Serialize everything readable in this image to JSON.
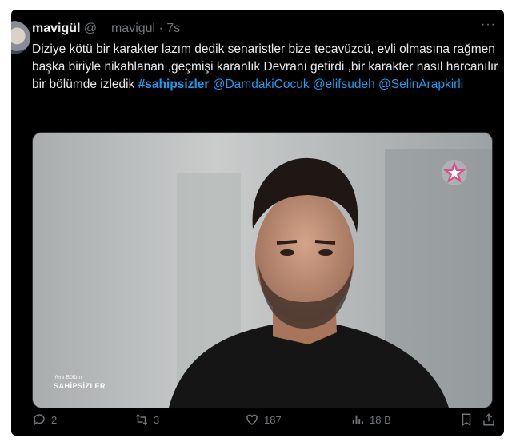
{
  "tweet": {
    "display_name": "mavigül",
    "handle": "@__mavigul",
    "separator": "·",
    "time": "7s",
    "more_label": "···",
    "text_before": "Diziye kötü bir karakter lazım dedik senaristler bize tecavüzcü, evli olmasına rağmen başka biriyle nikahlanan ,geçmişi karanlık Devranı getirdi ,bir karakter nasıl harcanılır bir bölümde izledik ",
    "hashtag": "#sahipsizler",
    "mention1": "@DamdakiCocuk",
    "mention2": "@elifsudeh",
    "mention3": "@SelinArapkirli"
  },
  "media": {
    "overlay_small": "Yeni Bölüm",
    "overlay_big": "SAHİPSİZLER",
    "logo_icon": "star-tv-logo"
  },
  "actions": {
    "reply_count": "2",
    "retweet_count": "3",
    "like_count": "187",
    "views_count": "18 B"
  },
  "colors": {
    "background": "#000000",
    "text": "#e7e9ea",
    "muted": "#71767b",
    "link": "#1d9bf0"
  }
}
